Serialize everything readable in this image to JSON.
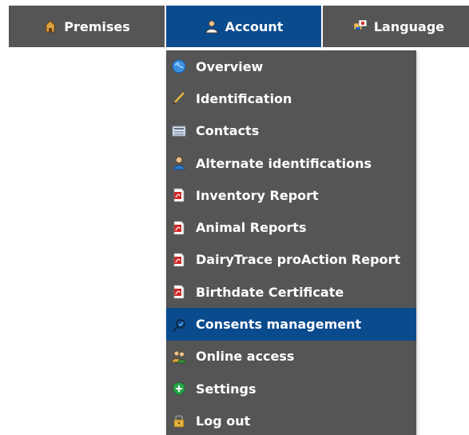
{
  "topnav": {
    "tabs": [
      {
        "label": "Premises",
        "icon": "house-icon",
        "active": false
      },
      {
        "label": "Account",
        "icon": "user-icon",
        "active": true
      },
      {
        "label": "Language",
        "icon": "flag-icon",
        "active": false
      }
    ]
  },
  "account_menu": {
    "items": [
      {
        "label": "Overview",
        "icon": "globe-icon"
      },
      {
        "label": "Identification",
        "icon": "pencil-icon"
      },
      {
        "label": "Contacts",
        "icon": "address-book-icon"
      },
      {
        "label": "Alternate identifications",
        "icon": "user-icon"
      },
      {
        "label": "Inventory Report",
        "icon": "pdf-icon"
      },
      {
        "label": "Animal Reports",
        "icon": "pdf-icon"
      },
      {
        "label": "DairyTrace proAction Report",
        "icon": "pdf-icon"
      },
      {
        "label": "Birthdate Certificate",
        "icon": "pdf-icon"
      },
      {
        "label": "Consents management",
        "icon": "consent-icon",
        "active": true
      },
      {
        "label": "Online access",
        "icon": "users-icon"
      },
      {
        "label": "Settings",
        "icon": "plus-shield-icon"
      },
      {
        "label": "Log out",
        "icon": "lock-icon"
      }
    ]
  },
  "colors": {
    "nav_bg": "#555555",
    "active_bg": "#0a4b8e",
    "text": "#ffffff"
  }
}
